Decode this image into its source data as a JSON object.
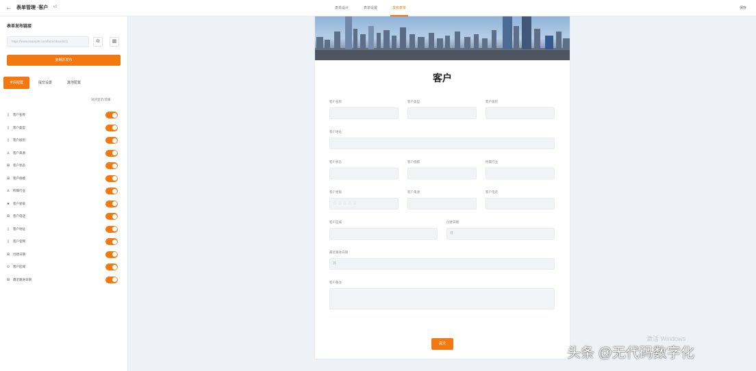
{
  "topbar": {
    "title": "表单管理 ·客户",
    "version": "v1",
    "tabs": [
      "表单设计",
      "表单设置",
      "发布表单"
    ],
    "active_tab": 2,
    "right": "保存"
  },
  "sidebar": {
    "title": "表单发布链接",
    "url": "https://www.example.com/form/share/4c1",
    "publish_button": "复制并发布",
    "tabs": [
      "字段配置",
      "提交设置",
      "其他配置"
    ],
    "active_tab": 0,
    "column_header": "对外显示/可填",
    "fields": [
      {
        "icon": "text-icon",
        "glyph": "▯",
        "name": "客户名称"
      },
      {
        "icon": "text-icon",
        "glyph": "▯",
        "name": "客户类型"
      },
      {
        "icon": "text-icon",
        "glyph": "▯",
        "name": "客户级别"
      },
      {
        "icon": "user-icon",
        "glyph": "♙",
        "name": "客户来源"
      },
      {
        "icon": "grid-icon",
        "glyph": "⊞",
        "name": "客户状态"
      },
      {
        "icon": "grid-icon",
        "glyph": "⊞",
        "name": "客户规模"
      },
      {
        "icon": "user-icon",
        "glyph": "♙",
        "name": "所属行业"
      },
      {
        "icon": "star-icon",
        "glyph": "★",
        "name": "客户星级"
      },
      {
        "icon": "grid-icon",
        "glyph": "⊞",
        "name": "客户电话"
      },
      {
        "icon": "text-icon",
        "glyph": "▯",
        "name": "客户地址"
      },
      {
        "icon": "text-icon",
        "glyph": "▯",
        "name": "客户官网"
      },
      {
        "icon": "grid-icon",
        "glyph": "⊞",
        "name": "创建日期"
      },
      {
        "icon": "location-icon",
        "glyph": "⊙",
        "name": "客户区域"
      },
      {
        "icon": "grid-icon",
        "glyph": "⊞",
        "name": "最近跟进日期"
      }
    ]
  },
  "form": {
    "title": "客户",
    "labels": {
      "name": "客户名称",
      "type": "客户类型",
      "level": "客户级别",
      "address": "客户地址",
      "status": "客户状态",
      "scale": "客户规模",
      "industry": "所属行业",
      "star": "客户星级",
      "source": "客户来源",
      "phone": "客户电话",
      "region": "客户区域",
      "created": "创建日期",
      "followup": "最近跟进日期",
      "remark": "客户备注"
    },
    "date_placeholder": "日",
    "stars": "☆☆☆☆☆",
    "submit": "提交"
  },
  "watermark": "激活 Windows",
  "credit": "头条 @无代码数字化",
  "colors": {
    "accent": "#f2780f",
    "background": "#eef1f6"
  }
}
